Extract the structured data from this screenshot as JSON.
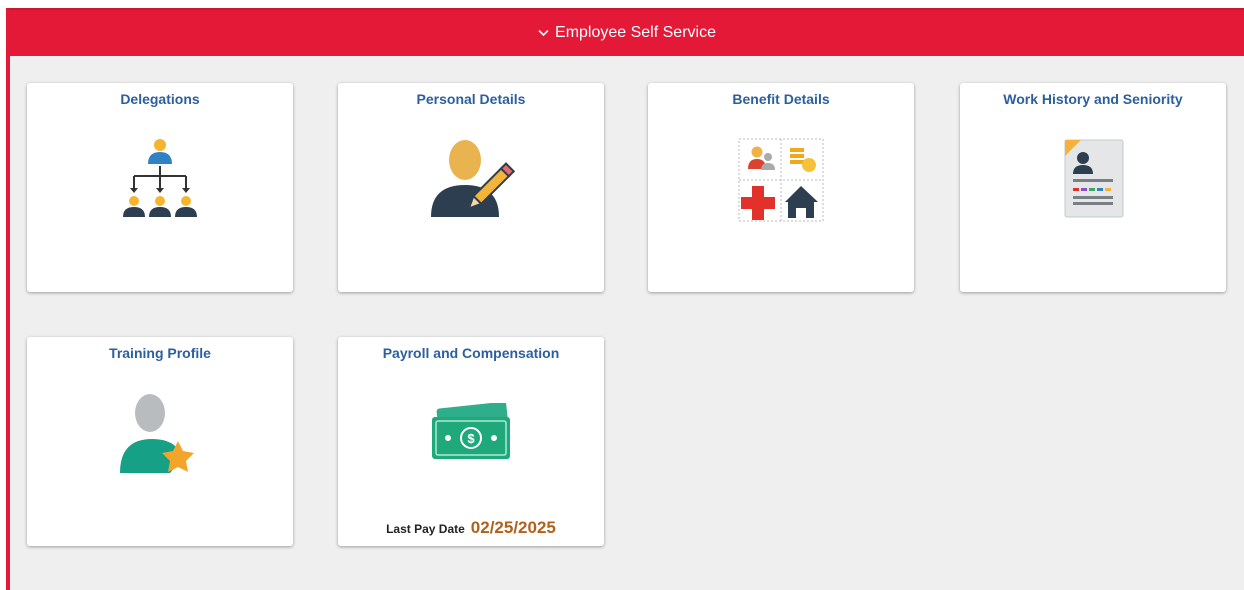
{
  "header": {
    "title": "Employee Self Service",
    "chevron_icon": "chevron-down-icon",
    "color": "#e31937"
  },
  "tiles": [
    {
      "label": "Delegations",
      "icon": "org-chart-icon"
    },
    {
      "label": "Personal Details",
      "icon": "person-edit-icon"
    },
    {
      "label": "Benefit Details",
      "icon": "benefits-grid-icon"
    },
    {
      "label": "Work History and Seniority",
      "icon": "resume-document-icon"
    },
    {
      "label": "Training Profile",
      "icon": "person-star-icon"
    },
    {
      "label": "Payroll and Compensation",
      "icon": "money-bills-icon",
      "pay_label": "Last Pay Date",
      "pay_value": "02/25/2025"
    }
  ],
  "colors": {
    "title": "#2c5f9e",
    "pay_date": "#b2611a",
    "background": "#efefef"
  }
}
